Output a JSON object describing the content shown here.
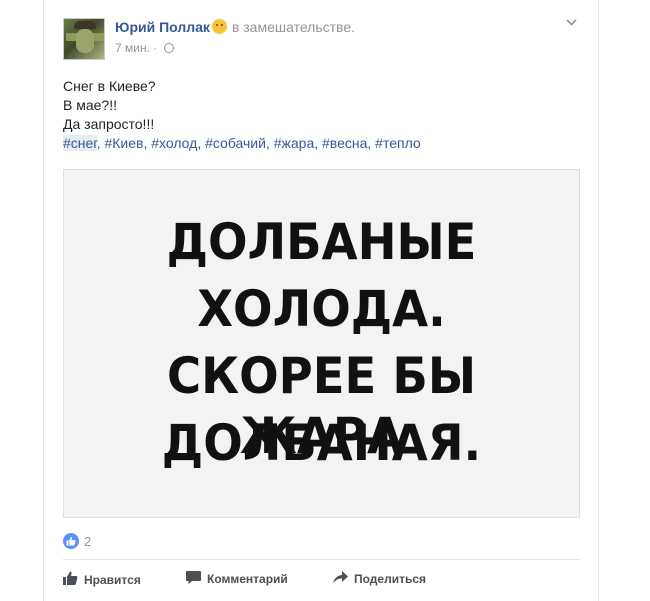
{
  "post": {
    "author": "Юрий Поллак",
    "feeling": "в замешательстве.",
    "time": "7 мин.",
    "separator": "·",
    "text_lines": [
      "Снег в Киеве?",
      "В мае?!!",
      "Да запросто!!!"
    ],
    "tags_first": "#снег",
    "tags_rest": ", #Киев, #холод, #собачий, #жара, #весна, #тепло",
    "image_lines": [
      "ДОЛБАНЫЕ",
      "ХОЛОДА.",
      "СКОРЕЕ БЫ ЖАРА",
      "ДОЛБАНАЯ."
    ],
    "reactions_count": "2"
  },
  "actions": {
    "like": "Нравится",
    "comment": "Комментарий",
    "share": "Поделиться"
  },
  "icons": {
    "feeling": "confused-emoji-icon",
    "privacy": "globe-icon",
    "menu": "chevron-down-icon",
    "reaction": "like-reaction-icon",
    "like": "thumbs-up-icon",
    "comment": "comment-icon",
    "share": "share-arrow-icon"
  },
  "colors": {
    "link": "#365899",
    "muted": "#90949c",
    "like_blue": "#5890ff"
  }
}
